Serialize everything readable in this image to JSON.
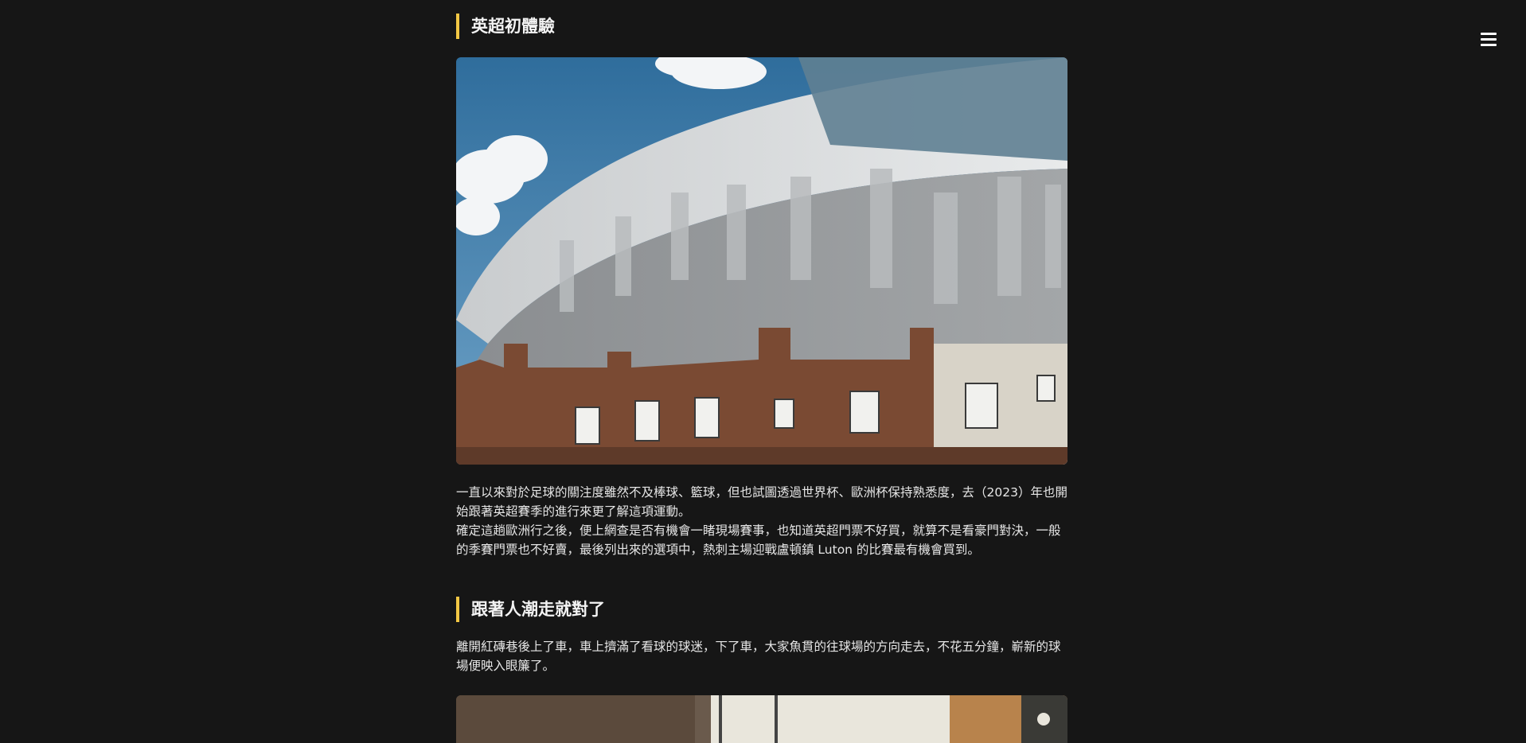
{
  "nav": {
    "menu_icon": "hamburger-menu-icon"
  },
  "sections": [
    {
      "title": "英超初體驗",
      "paragraphs": [
        "一直以來對於足球的關注度雖然不及棒球、籃球，但也試圖透過世界杯、歐洲杯保持熟悉度，去（2023）年也開始跟著英超賽季的進行來更了解這項運動。",
        "確定這趟歐洲行之後，便上網查是否有機會一睹現場賽事，也知道英超門票不好買，就算不是看豪門對決，一般的季賽門票也不好賣，最後列出來的選項中，熱刺主場迎戰盧頓鎮 Luton 的比賽最有機會買到。"
      ]
    },
    {
      "title": "跟著人潮走就對了",
      "paragraphs": [
        "離開紅磚巷後上了車，車上擠滿了看球的球迷，下了車，大家魚貫的往球場的方向走去，不花五分鐘，嶄新的球場便映入眼簾了。"
      ]
    }
  ],
  "colors": {
    "background": "#161616",
    "accent": "#f2c744",
    "text": "#e6e6e6"
  }
}
